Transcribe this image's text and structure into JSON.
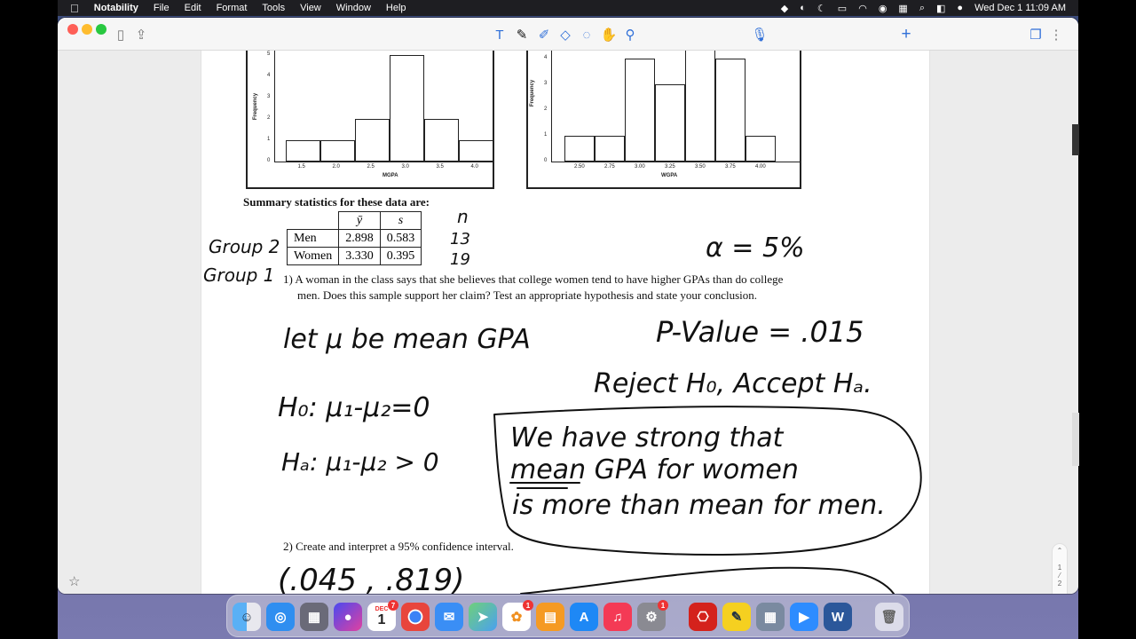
{
  "menubar": {
    "app_name": "Notability",
    "menus": [
      "File",
      "Edit",
      "Format",
      "Tools",
      "View",
      "Window",
      "Help"
    ],
    "clock": "Wed Dec 1  11:09 AM"
  },
  "toolbar": {
    "tools": [
      "text-tool",
      "pen-tool",
      "highlighter-tool",
      "eraser-tool",
      "lasso-tool",
      "hand-tool",
      "link-tool"
    ],
    "mic": "microphone",
    "add": "+"
  },
  "document": {
    "hist_left": {
      "xlabel": "MGPA",
      "ylabel": "Frequency",
      "yticks": [
        "5",
        "4",
        "3",
        "2",
        "1",
        "0"
      ],
      "xticks": [
        "1.5",
        "2.0",
        "2.5",
        "3.0",
        "3.5",
        "4.0"
      ],
      "bars": [
        1,
        1,
        2,
        5,
        2,
        1
      ]
    },
    "hist_right": {
      "xlabel": "WGPA",
      "ylabel": "Frequency",
      "yticks": [
        "4",
        "3",
        "2",
        "1",
        "0"
      ],
      "xticks": [
        "2.50",
        "2.75",
        "3.00",
        "3.25",
        "3.50",
        "3.75",
        "4.00"
      ],
      "bars": [
        1,
        1,
        4,
        3,
        5,
        4,
        1
      ]
    },
    "summary_heading": "Summary statistics for these data are:",
    "table": {
      "headers": [
        "",
        "ȳ",
        "s"
      ],
      "rows": [
        [
          "Men",
          "2.898",
          "0.583"
        ],
        [
          "Women",
          "3.330",
          "0.395"
        ]
      ]
    },
    "q1_line1": "1)  A woman in the class says that she believes that college women tend to have higher GPAs than do college",
    "q1_line2": "men. Does this sample support her claim? Test an appropriate hypothesis and state your conclusion.",
    "q2": "2) Create and interpret a 95% confidence interval."
  },
  "handwriting": {
    "group2": "Group 2",
    "group1": "Group 1",
    "n_men": "13",
    "n_women": "19",
    "n_label": "n",
    "alpha": "α = 5%",
    "let_mu": "let μ be  mean  GPA",
    "pvalue": "P-Value = .015",
    "reject": "Reject H₀, Accept Hₐ.",
    "h0": "H₀:   μ₁-μ₂=0",
    "ha": "Hₐ:   μ₁-μ₂ > 0",
    "box_line1": "We have strong that",
    "box_line2": "mean  GPA for women",
    "box_line3": "is more than  mean for men.",
    "ci": "(.045 , .819)"
  },
  "pagenav": {
    "current": "1",
    "total": "2"
  },
  "dock": {
    "apps": [
      "Finder",
      "Safari",
      "Launchpad",
      "Siri",
      "Calendar",
      "Chrome",
      "Mail",
      "Maps",
      "Photos",
      "Books",
      "App Store",
      "Music",
      "System Preferences",
      "Acrobat",
      "Notability",
      "Calculator",
      "Zoom",
      "Word",
      "Trash"
    ],
    "calendar_month": "DEC",
    "calendar_day": "1"
  }
}
